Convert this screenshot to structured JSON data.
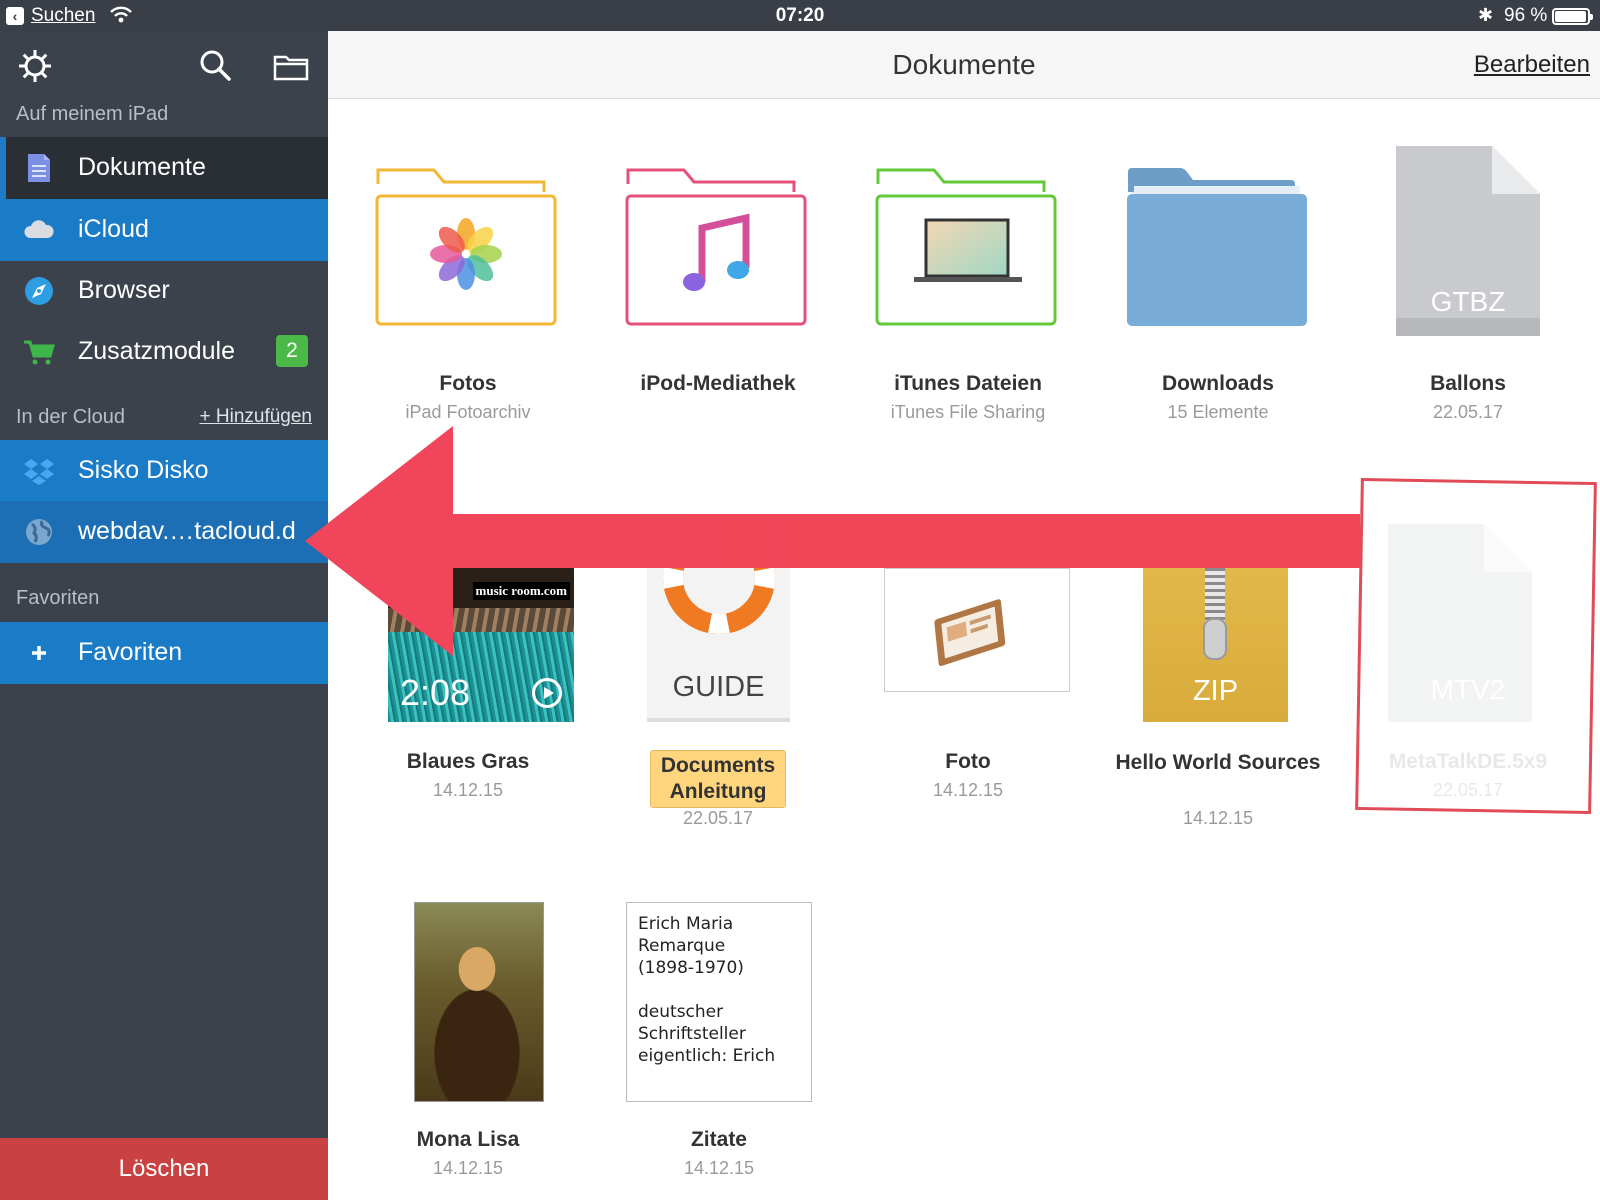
{
  "status_bar": {
    "back_label": "Suchen",
    "time": "07:20",
    "battery_percent": "96 %",
    "battery_level": 0.96
  },
  "sidebar": {
    "on_device_header": "Auf meinem iPad",
    "items": [
      {
        "label": "Dokumente",
        "icon": "document-icon"
      },
      {
        "label": "iCloud",
        "icon": "cloud-icon"
      },
      {
        "label": "Browser",
        "icon": "compass-icon"
      },
      {
        "label": "Zusatzmodule",
        "icon": "cart-icon",
        "badge": "2"
      }
    ],
    "cloud_header": "In der Cloud",
    "add_link": "+ Hinzufügen",
    "cloud_items": [
      {
        "label": "Sisko Disko",
        "icon": "dropbox-icon"
      },
      {
        "label": "webdav.…tacloud.d",
        "icon": "globe-icon"
      }
    ],
    "favorites_header": "Favoriten",
    "favorites_item": "Favoriten",
    "delete_label": "Löschen"
  },
  "topbar": {
    "title": "Dokumente",
    "edit_label": "Bearbeiten"
  },
  "grid": {
    "row1": [
      {
        "name": "Fotos",
        "sub": "iPad Fotoarchiv"
      },
      {
        "name": "iPod-Mediathek",
        "sub": ""
      },
      {
        "name": "iTunes Dateien",
        "sub": "iTunes File Sharing"
      },
      {
        "name": "Downloads",
        "sub": "15 Elemente"
      },
      {
        "name": "Ballons",
        "sub": "22.05.17",
        "badge": "GTBZ"
      }
    ],
    "row2": [
      {
        "name": "Blaues Gras",
        "sub": "14.12.15",
        "duration": "2:08",
        "brand": "music room.com"
      },
      {
        "name": "Documents Anleitung",
        "sub": "22.05.17",
        "badge": "GUIDE"
      },
      {
        "name": "Foto",
        "sub": "14.12.15"
      },
      {
        "name": "Hello World Sources",
        "sub": "14.12.15",
        "badge": "ZIP"
      },
      {
        "name": "MetaTalkDE.5x9",
        "sub": "22.05.17",
        "badge": "MTV2"
      }
    ],
    "row3": [
      {
        "name": "Mona Lisa",
        "sub": "14.12.15"
      },
      {
        "name": "Zitate",
        "sub": "14.12.15",
        "preview": "Erich Maria\nRemarque\n(1898-1970)\n\ndeutscher\nSchriftsteller\neigentlich: Erich"
      }
    ]
  },
  "colors": {
    "sidebar": "#3c424c",
    "sidebar_blue": "#1a7bc7",
    "delete": "#c94141",
    "arrow": "#f0455a",
    "badge_green": "#4cb848"
  }
}
